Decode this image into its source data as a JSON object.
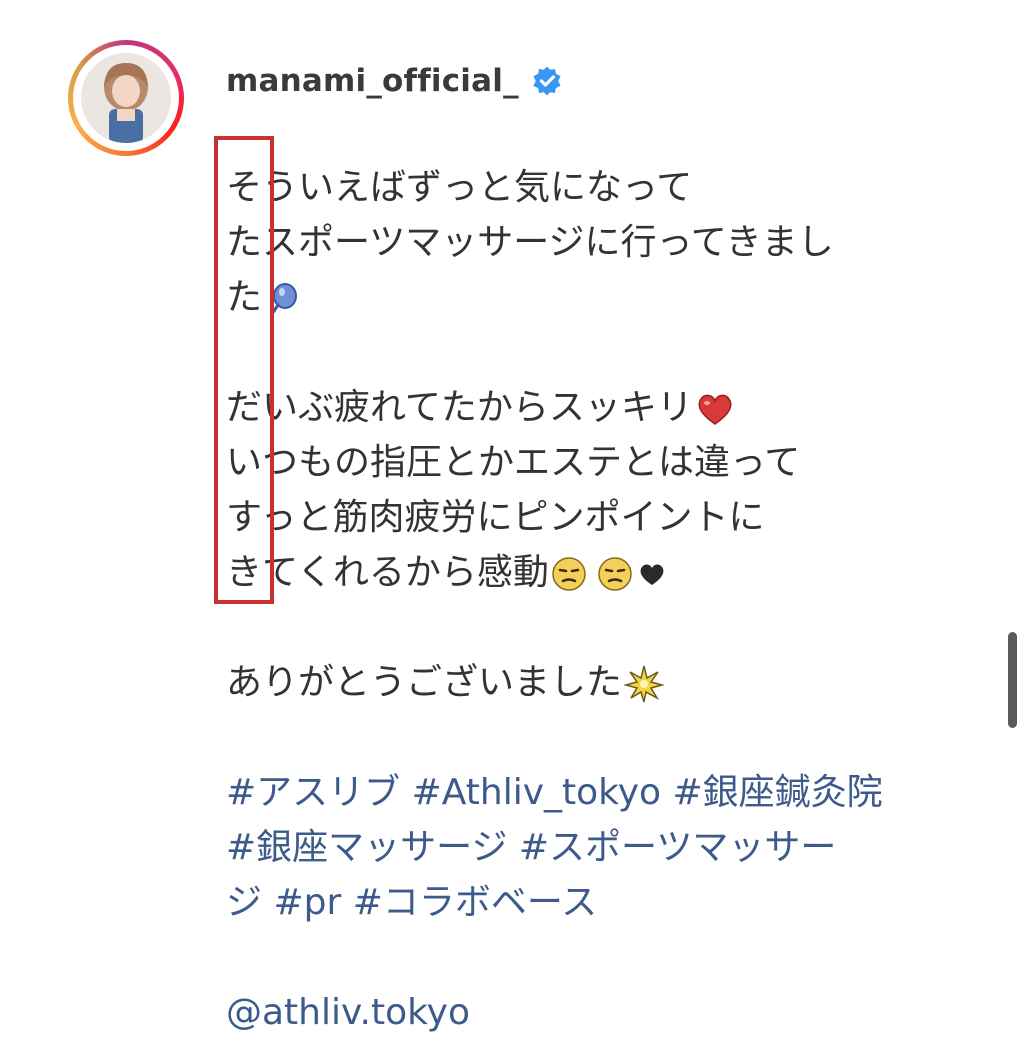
{
  "post": {
    "username": "manami_official_",
    "verified": true,
    "verified_icon": "blue-check-badge-icon",
    "caption_lines": [
      "そういえばずっと気になって",
      "たスポーツマッサージに行ってきまし",
      "た",
      "",
      "だいぶ疲れてたからスッキリ",
      "いつもの指圧とかエステとは違って",
      "すっと筋肉疲労にピンポイントに",
      "きてくれるから感動",
      "",
      "ありがとうございました"
    ],
    "hashtag_lines": [
      "#アスリブ #Athliv_tokyo #銀座鍼灸院",
      "#銀座マッサージ #スポーツマッサー",
      "ジ #pr #コラボベース"
    ],
    "mention": "@athliv.tokyo"
  },
  "colors": {
    "text": "#333333",
    "link": "#3c5a8a",
    "verified": "#3897f0",
    "highlight": "#c8312f"
  },
  "icons": {
    "line3": "balloon-icon",
    "line5": "red-heart-icon",
    "line8": [
      "relieved-face-icon",
      "relieved-face-icon",
      "black-heart-icon"
    ],
    "line10": "sparkle-star-icon"
  }
}
